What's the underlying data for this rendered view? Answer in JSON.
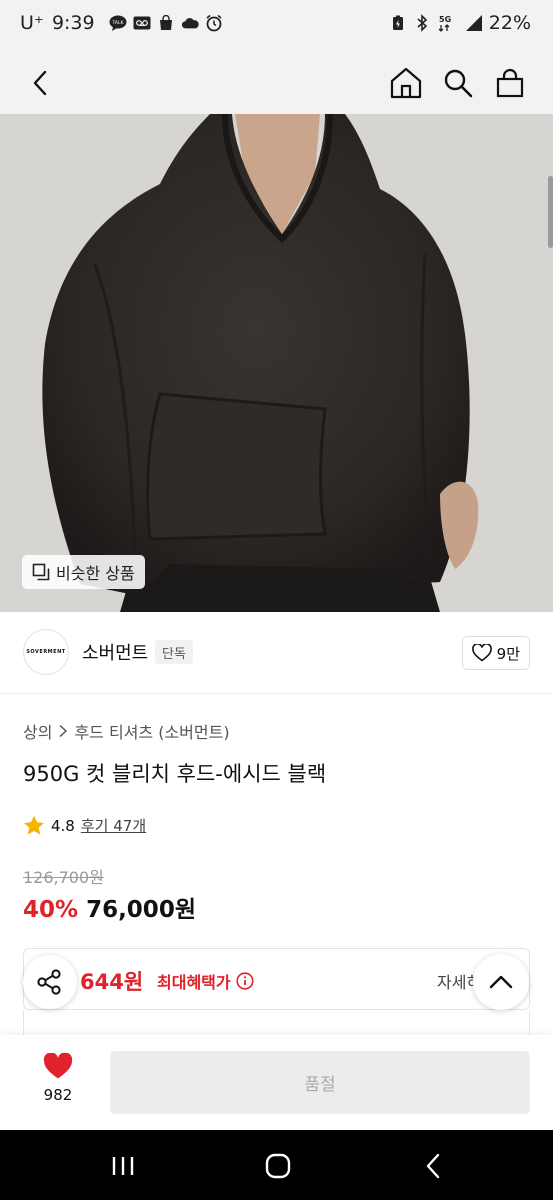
{
  "status_bar": {
    "carrier": "U⁺",
    "time": "9:39",
    "network": "5G",
    "battery": "22%"
  },
  "nav": {
    "back_icon": "chevron-left-icon",
    "home_icon": "home-icon",
    "search_icon": "search-icon",
    "cart_icon": "shopping-bag-icon"
  },
  "hero": {
    "similar_button": "비슷한 상품"
  },
  "brand": {
    "logo_text": "SOVERMENT",
    "name": "소버먼트",
    "tag": "단독",
    "likes": "9만"
  },
  "product": {
    "breadcrumb": [
      "상의",
      "후드 티셔츠 (소버먼트)"
    ],
    "title": "950G 컷 블리치 후드-에시드 블랙",
    "rating": "4.8",
    "reviews": "후기 47개",
    "original_price": "126,700원",
    "discount": "40%",
    "price": "76,000원"
  },
  "benefit": {
    "max_price": "644원",
    "label": "최대혜택가",
    "detail": "자세히"
  },
  "bottom_bar": {
    "wish_count": "982",
    "soldout_label": "품절"
  },
  "colors": {
    "accent_red": "#e0222c",
    "star": "#f4b400",
    "hoodie": "#2b2725"
  }
}
